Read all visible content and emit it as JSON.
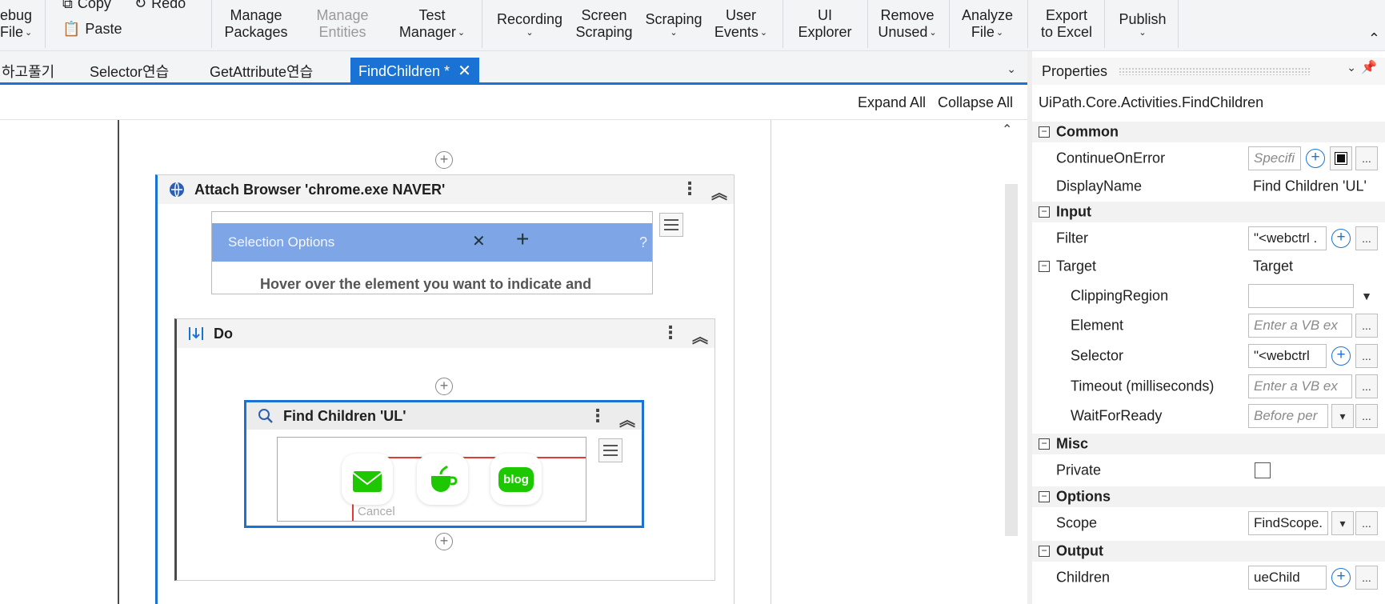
{
  "ribbon": {
    "debug_file": {
      "line1": "ebug",
      "line2": "File"
    },
    "copy": "Copy",
    "redo": "Redo",
    "paste": "Paste",
    "manage_packages": {
      "line1": "Manage",
      "line2": "Packages"
    },
    "manage_entities": {
      "line1": "Manage",
      "line2": "Entities"
    },
    "test_manager": {
      "line1": "Test",
      "line2": "Manager"
    },
    "recording": {
      "line1": "Recording"
    },
    "screen_scraping": {
      "line1": "Screen",
      "line2": "Scraping"
    },
    "scraping": {
      "line1": "Scraping"
    },
    "user_events": {
      "line1": "User",
      "line2": "Events"
    },
    "ui_explorer": {
      "line1": "UI",
      "line2": "Explorer"
    },
    "remove_unused": {
      "line1": "Remove",
      "line2": "Unused"
    },
    "analyze_file": {
      "line1": "Analyze",
      "line2": "File"
    },
    "export_excel": {
      "line1": "Export",
      "line2": "to Excel"
    },
    "publish": {
      "line1": "Publish"
    }
  },
  "tabs": [
    {
      "label": "하고풀기"
    },
    {
      "label": "Selector연습"
    },
    {
      "label": "GetAttribute연습"
    },
    {
      "label": "FindChildren *",
      "active": true
    }
  ],
  "designer": {
    "expand_all": "Expand All",
    "collapse_all": "Collapse All",
    "attach_title": "Attach Browser 'chrome.exe  NAVER'",
    "do_title": "Do",
    "find_title": "Find Children 'UL'",
    "shot1_title": "Selection Options",
    "shot1_hint": "Hover over the element you want to indicate and",
    "shot2_cancel": "Cancel",
    "blog_label": "blog"
  },
  "properties": {
    "title": "Properties",
    "type": "UiPath.Core.Activities.FindChildren",
    "categories": {
      "common": "Common",
      "input": "Input",
      "misc": "Misc",
      "options": "Options",
      "output": "Output"
    },
    "rows": {
      "continue_on_error": {
        "label": "ContinueOnError",
        "placeholder": "Specifi"
      },
      "display_name": {
        "label": "DisplayName",
        "value": "Find Children 'UL'"
      },
      "filter": {
        "label": "Filter",
        "value": "\"<webctrl ."
      },
      "target": {
        "label": "Target",
        "value": "Target"
      },
      "clipping_region": {
        "label": "ClippingRegion",
        "value": ""
      },
      "element": {
        "label": "Element",
        "placeholder": "Enter a VB ex"
      },
      "selector": {
        "label": "Selector",
        "value": "\"<webctrl"
      },
      "timeout": {
        "label": "Timeout (milliseconds)",
        "placeholder": "Enter a VB ex"
      },
      "wait_for_ready": {
        "label": "WaitForReady",
        "placeholder": "Before per"
      },
      "private": {
        "label": "Private"
      },
      "scope": {
        "label": "Scope",
        "value": "FindScope."
      },
      "children": {
        "label": "Children",
        "value": "ueChild"
      }
    },
    "ellipsis": "..."
  },
  "colors": {
    "accent": "#1a73d4",
    "selection_red": "#e53935"
  }
}
